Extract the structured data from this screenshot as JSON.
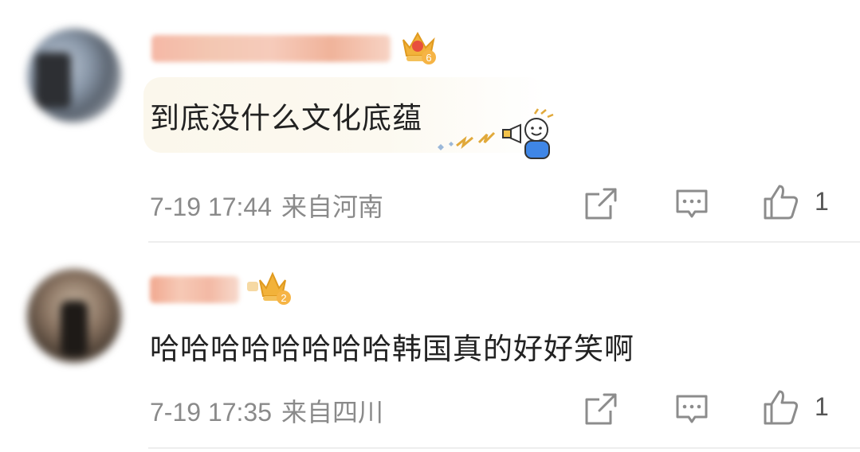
{
  "comments": [
    {
      "text": "到底没什么文化底蕴",
      "time": "7-19 17:44",
      "location": "来自河南",
      "likes": "1",
      "badge_level": "6"
    },
    {
      "text": "哈哈哈哈哈哈哈哈韩国真的好好笑啊",
      "time": "7-19 17:35",
      "location": "来自四川",
      "likes": "1",
      "badge_level": "2"
    }
  ],
  "icons": [
    "share-icon",
    "reply-icon",
    "like-icon",
    "crown-badge-icon"
  ],
  "colors": {
    "meta_text": "#8a8a8a",
    "icon_stroke": "#8c8c8c",
    "comment_text": "#222222",
    "bubble_bg": "#fbf7ec"
  }
}
